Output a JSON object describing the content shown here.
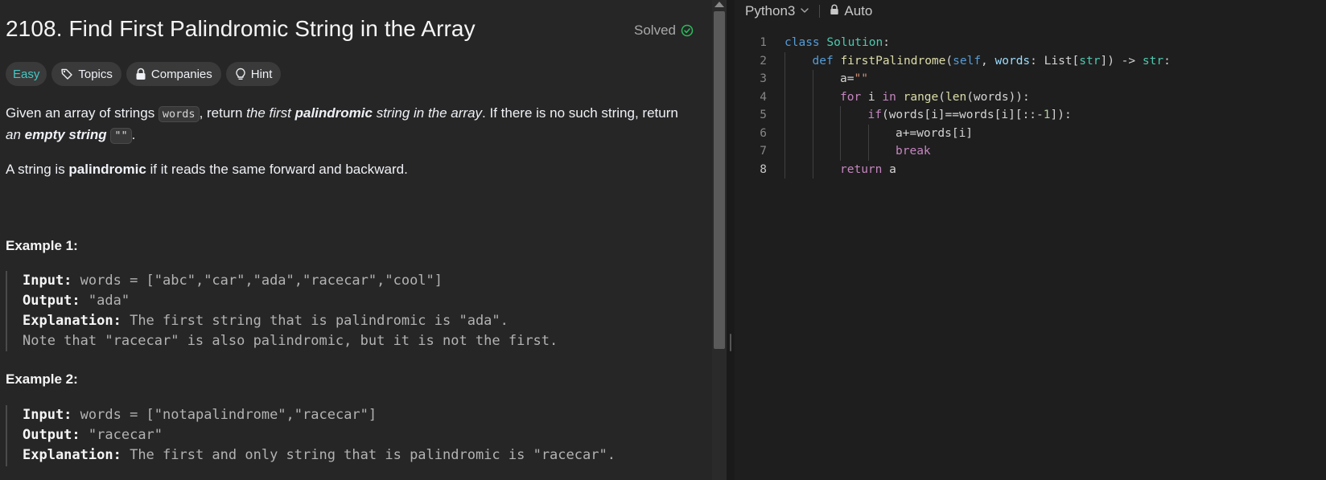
{
  "problem": {
    "title": "2108. Find First Palindromic String in the Array",
    "status": "Solved",
    "tags": {
      "difficulty": "Easy",
      "topics": "Topics",
      "companies": "Companies",
      "hint": "Hint"
    },
    "description": {
      "p1_a": "Given an array of strings ",
      "p1_code": "words",
      "p1_b": ", return ",
      "p1_c": "the first ",
      "p1_d": "palindromic",
      "p1_e": " string in the array",
      "p1_f": ". If there is no such string, return",
      "p1_g": "an ",
      "p1_h": "empty string",
      "p1_code2": "\"\"",
      "p1_i": ".",
      "p2_a": "A string is ",
      "p2_b": "palindromic",
      "p2_c": " if it reads the same forward and backward."
    },
    "examples": [
      {
        "title": "Example 1:",
        "input_label": "Input:",
        "input": "words = [\"abc\",\"car\",\"ada\",\"racecar\",\"cool\"]",
        "output_label": "Output:",
        "output": "\"ada\"",
        "explanation_label": "Explanation:",
        "explanation": "The first string that is palindromic is \"ada\".",
        "note": "Note that \"racecar\" is also palindromic, but it is not the first."
      },
      {
        "title": "Example 2:",
        "input_label": "Input:",
        "input": "words = [\"notapalindrome\",\"racecar\"]",
        "output_label": "Output:",
        "output": "\"racecar\"",
        "explanation_label": "Explanation:",
        "explanation": "The first and only string that is palindromic is \"racecar\"."
      }
    ]
  },
  "editor": {
    "language": "Python3",
    "mode": "Auto",
    "active_line": 8,
    "lines": [
      {
        "n": "1",
        "indent": 0,
        "tokens": [
          [
            "kw",
            "class"
          ],
          [
            "p",
            " "
          ],
          [
            "cls",
            "Solution"
          ],
          [
            "p",
            ":"
          ]
        ]
      },
      {
        "n": "2",
        "indent": 1,
        "tokens": [
          [
            "kw",
            "def"
          ],
          [
            "p",
            " "
          ],
          [
            "fn",
            "firstPalindrome"
          ],
          [
            "p",
            "("
          ],
          [
            "slf",
            "self"
          ],
          [
            "p",
            ", "
          ],
          [
            "prm",
            "words"
          ],
          [
            "p",
            ": List["
          ],
          [
            "bi",
            "str"
          ],
          [
            "p",
            "]) -> "
          ],
          [
            "bi",
            "str"
          ],
          [
            "p",
            ":"
          ]
        ]
      },
      {
        "n": "3",
        "indent": 2,
        "tokens": [
          [
            "p",
            "a="
          ],
          [
            "str",
            "\"\""
          ]
        ]
      },
      {
        "n": "4",
        "indent": 2,
        "tokens": [
          [
            "ctl",
            "for"
          ],
          [
            "p",
            " i "
          ],
          [
            "ctl",
            "in"
          ],
          [
            "p",
            " "
          ],
          [
            "fn",
            "range"
          ],
          [
            "p",
            "("
          ],
          [
            "fn",
            "len"
          ],
          [
            "p",
            "(words)):"
          ]
        ]
      },
      {
        "n": "5",
        "indent": 3,
        "tokens": [
          [
            "ctl",
            "if"
          ],
          [
            "p",
            "(words[i]==words[i][::-"
          ],
          [
            "num",
            "1"
          ],
          [
            "p",
            "]):"
          ]
        ]
      },
      {
        "n": "6",
        "indent": 4,
        "tokens": [
          [
            "p",
            "a+=words[i]"
          ]
        ]
      },
      {
        "n": "7",
        "indent": 4,
        "tokens": [
          [
            "ctl",
            "break"
          ]
        ]
      },
      {
        "n": "8",
        "indent": 2,
        "tokens": [
          [
            "ctl",
            "return"
          ],
          [
            "p",
            " a"
          ]
        ]
      }
    ]
  },
  "colors": {
    "easy": "#46c6c2",
    "solved_check": "#2cbb5d",
    "panel_bg": "#262626",
    "editor_bg": "#1e1e1e"
  }
}
